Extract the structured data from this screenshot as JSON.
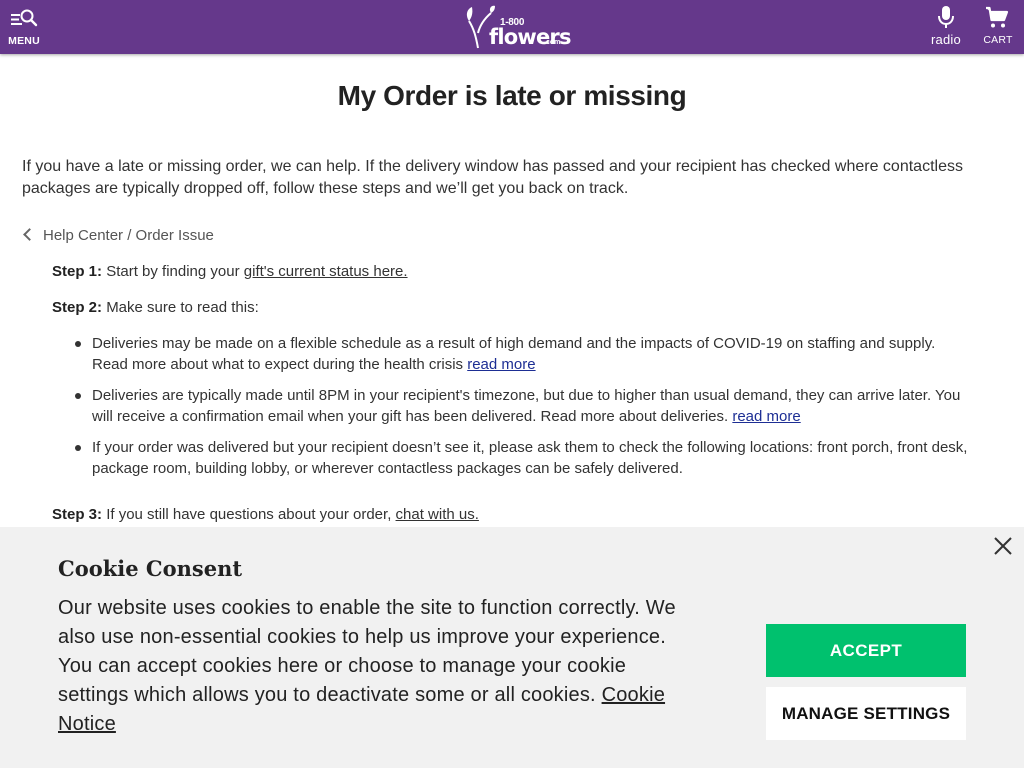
{
  "header": {
    "menu_label": "MENU",
    "logo_text_number": "1-800",
    "logo_text_brand": "flowers",
    "logo_text_tld": ".com",
    "radio_label": "radio",
    "cart_label": "CART",
    "bg_color": "#65388b",
    "icons": {
      "menu": "menu-search-icon",
      "radio": "microphone-icon",
      "cart": "cart-icon"
    }
  },
  "page": {
    "title": "My Order is late or missing",
    "intro": "If you have a late or missing order, we can help. If the delivery window has passed and your recipient has checked where contactless packages are typically dropped off, follow these steps and we’ll get you back on track.",
    "breadcrumb": "Help Center / Order Issue"
  },
  "steps": {
    "step1_label": "Step 1:",
    "step1_text": "Start by finding your",
    "step1_link": "gift's current status here.",
    "step2_label": "Step 2:",
    "step2_text": "Make sure to read this:",
    "bullets": [
      {
        "text": "Deliveries may be made on a flexible schedule as a result of high demand and the impacts of COVID-19 on staffing and supply. Read more about what to expect during the health crisis",
        "link": "read more"
      },
      {
        "text": "Deliveries are typically made until 8PM in your recipient's timezone, but due to higher than usual demand, they can arrive later. You will receive a confirmation email when your gift has been delivered. Read more about deliveries.",
        "link": "read more"
      },
      {
        "text": "If your order was delivered but your recipient doesn’t see it, please ask them to check the following locations: front porch, front desk, package room, building lobby, or wherever contactless packages can be safely delivered."
      }
    ],
    "step3_label": "Step 3:",
    "step3_text": "If you still have questions about your order,",
    "step3_link": "chat with us."
  },
  "cookie": {
    "title": "Cookie Consent",
    "body": "Our website uses cookies to enable the site to function correctly. We also use non-essential cookies to help us improve your experience. You can accept cookies here or choose to manage your cookie settings which allows you to deactivate some or all cookies.",
    "notice_link": "Cookie Notice",
    "accept_label": "ACCEPT",
    "manage_label": "MANAGE SETTINGS",
    "accept_color": "#00c16e"
  }
}
